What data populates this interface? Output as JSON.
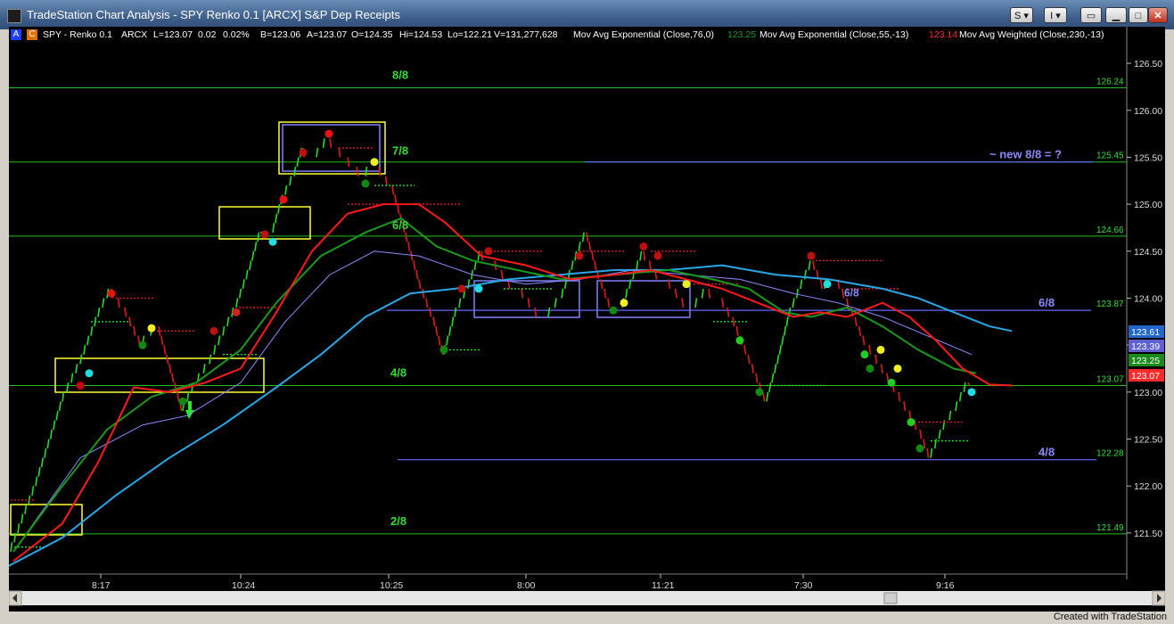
{
  "window": {
    "title": "TradeStation Chart Analysis - SPY Renko 0.1 [ARCX] S&P Dep Receipts",
    "btn_s": "S",
    "btn_i": "I",
    "footer": "Created with TradeStation"
  },
  "legend": {
    "a": "A",
    "c": "C",
    "symbol": "SPY - Renko 0.1",
    "exchange": "ARCX",
    "last": "L=123.07",
    "chg": "0.02",
    "pct": "0.02%",
    "bid": "B=123.06",
    "ask": "A=123.07",
    "open": "O=124.35",
    "high": "Hi=124.53",
    "low": "Lo=122.21",
    "volume": "V=131,277,628",
    "ind1": "Mov Avg Exponential (Close,76,0)",
    "ind1_val": "123.25",
    "ind2": "Mov Avg Exponential (Close,55,-13)",
    "ind2_val": "123.14",
    "ind3": "Mov Avg Weighted (Close,230,-13)"
  },
  "colors": {
    "green_ma": "#1a9a1a",
    "red_ma": "#ff1a1a",
    "blue_ma": "#29a8e8",
    "lilac_ma": "#8c8cff",
    "murrey_green": "#22c022",
    "murrey_blue": "#6666ff",
    "box_yellow": "#ffff33",
    "box_blue": "#8080ff",
    "bar_green": "#22e022",
    "bar_red": "#e01a1a"
  },
  "chart_data": {
    "type": "renko",
    "y_range": [
      121.1,
      126.7
    ],
    "y_ticks": [
      "126.50",
      "126.00",
      "125.50",
      "125.00",
      "124.50",
      "124.00",
      "123.50",
      "123.00",
      "122.50",
      "122.00",
      "121.50"
    ],
    "y_tick_values": [
      126.5,
      126.0,
      125.5,
      125.0,
      124.5,
      124.0,
      123.5,
      123.0,
      122.5,
      122.0,
      121.5
    ],
    "x_ticks": [
      "8:17",
      "10:24",
      "10:25",
      "8:00",
      "11:21",
      "7:30",
      "9:16"
    ],
    "murrey_levels": [
      {
        "label": "8/8",
        "price": 126.24,
        "value_label": "126.24"
      },
      {
        "label": "7/8",
        "price": 125.45,
        "value_label": "125.45"
      },
      {
        "label": "6/8",
        "price": 124.66,
        "value_label": "124.66"
      },
      {
        "label": "4/8",
        "price": 123.07,
        "value_label": "123.07"
      },
      {
        "label": "2/8",
        "price": 121.49,
        "value_label": "121.49"
      }
    ],
    "blue_levels": [
      {
        "label": "~  new  8/8 = ?",
        "price": 125.45
      },
      {
        "label": "6/8",
        "price": 123.87,
        "value_label": "123.87"
      },
      {
        "label": "4/8",
        "price": 122.28,
        "value_label": "122.28"
      }
    ],
    "right_tags": [
      {
        "value": "123.61",
        "color": "#2266cc",
        "text_color": "#ffffff"
      },
      {
        "value": "123.39",
        "color": "#6060d0",
        "text_color": "#ffffff"
      },
      {
        "value": "123.25",
        "color": "#1a8a1a",
        "text_color": "#ffffff"
      },
      {
        "value": "123.07",
        "color": "#ff2a2a",
        "text_color": "#ffffff"
      }
    ],
    "inner_tag": "6/8"
  }
}
